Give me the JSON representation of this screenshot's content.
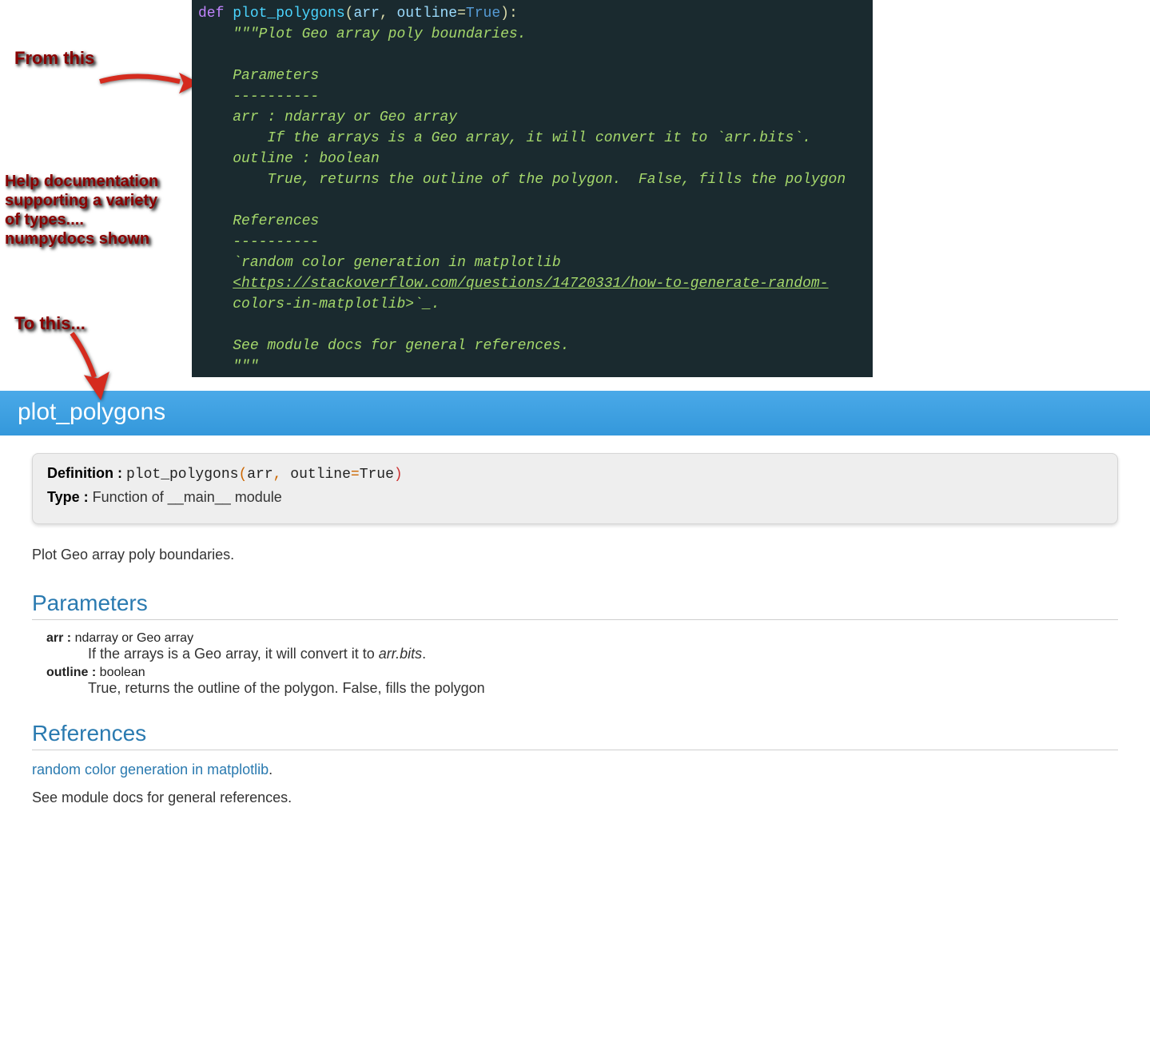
{
  "annotations": {
    "from": "From this",
    "help": "Help documentation supporting a variety of types.... numpydocs shown",
    "to": "To this..."
  },
  "code": {
    "def_kw": "def",
    "fn_name": "plot_polygons",
    "params_open": "(",
    "param1": "arr",
    "comma": ", ",
    "param2": "outline",
    "eq": "=",
    "bool_true": "True",
    "params_close": "):",
    "indent": "    ",
    "doc": {
      "open": "\"\"\"",
      "summary": "Plot Geo array poly boundaries.",
      "params_hdr": "Parameters",
      "dashes": "----------",
      "p1_line": "arr : ndarray or Geo array",
      "p1_desc": "    If the arrays is a Geo array, it will convert it to `arr.bits`.",
      "p2_line": "outline : boolean",
      "p2_desc": "    True, returns the outline of the polygon.  False, fills the polygon",
      "refs_hdr": "References",
      "refs_title": "`random color generation in matplotlib",
      "refs_url": "<https://stackoverflow.com/questions/14720331/how-to-generate-random-",
      "refs_url2": "colors-in-matplotlib>`_.",
      "see_also": "See module docs for general references.",
      "close": "\"\"\""
    }
  },
  "doc": {
    "title": "plot_polygons",
    "definition_label": "Definition :",
    "signature_prefix": " plot_polygons",
    "signature_params": "arr, outline=True",
    "type_label": "Type :",
    "type_value": " Function of __main__ module",
    "summary": "Plot Geo array poly boundaries.",
    "sections": {
      "parameters": "Parameters",
      "references": "References"
    },
    "params": [
      {
        "name": "arr :",
        "type": " ndarray or Geo array",
        "desc_pre": "If the arrays is a Geo array, it will convert it to ",
        "desc_em": "arr.bits",
        "desc_post": "."
      },
      {
        "name": "outline :",
        "type": " boolean",
        "desc": "True, returns the outline of the polygon. False, fills the polygon"
      }
    ],
    "ref_link": "random color generation in matplotlib",
    "ref_link_suffix": ".",
    "ref_text": "See module docs for general references."
  }
}
